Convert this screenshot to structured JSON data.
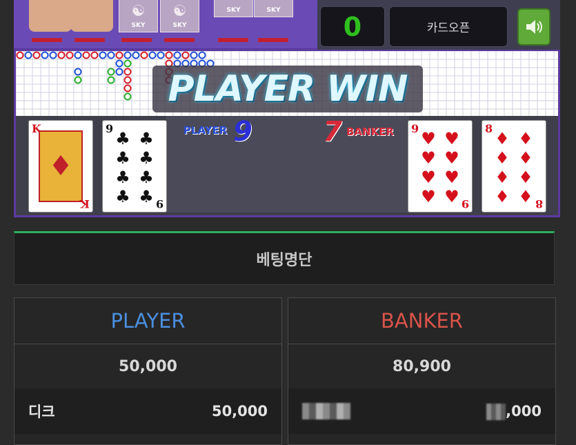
{
  "game": {
    "chip_brand": "SKY",
    "round_count": "0",
    "card_open_label": "카드오픈",
    "result_banner": "PLAYER WIN",
    "player": {
      "label": "PLAYER",
      "score": "9",
      "cards": [
        {
          "rank": "K",
          "suit": "♦"
        },
        {
          "rank": "9",
          "suit": "♣"
        }
      ]
    },
    "banker": {
      "label": "BANKER",
      "score": "7",
      "cards": [
        {
          "rank": "9",
          "suit": "♥"
        },
        {
          "rank": "8",
          "suit": "♦"
        }
      ]
    }
  },
  "betting_list": {
    "title": "베팅명단",
    "player": {
      "label": "PLAYER",
      "total": "50,000",
      "rows": [
        {
          "name": "디크",
          "amount": "50,000"
        }
      ]
    },
    "banker": {
      "label": "BANKER",
      "total": "80,900",
      "rows": [
        {
          "name": "",
          "amount": ",000"
        }
      ]
    }
  },
  "colors": {
    "player": "#4a8fe0",
    "banker": "#d9534a",
    "accent": "#2bb05a"
  }
}
